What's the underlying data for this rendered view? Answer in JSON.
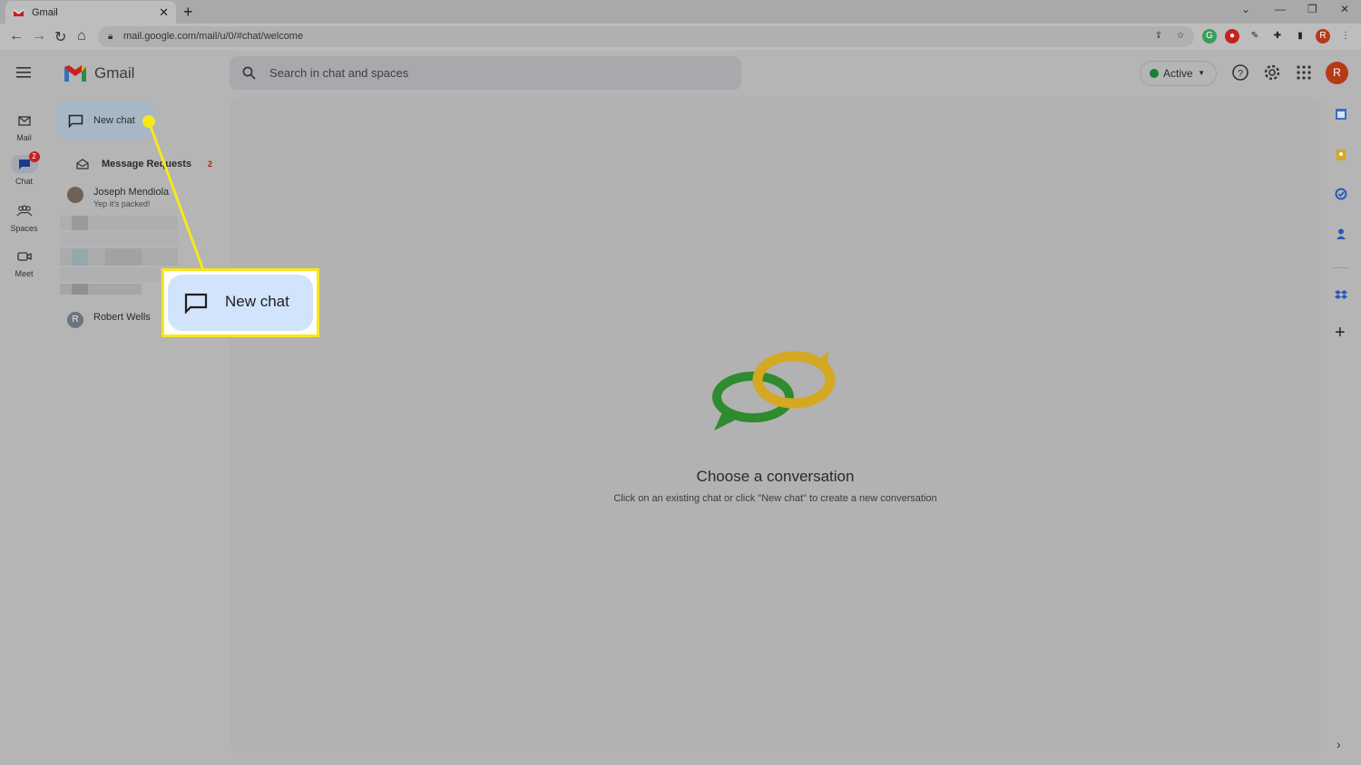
{
  "browser": {
    "tab_title": "Gmail",
    "url": "mail.google.com/mail/u/0/#chat/welcome",
    "profile_initial": "R"
  },
  "app": {
    "logo_text": "Gmail",
    "search_placeholder": "Search in chat and spaces",
    "status_label": "Active",
    "avatar_initial": "R"
  },
  "rail": {
    "items": [
      {
        "label": "Mail",
        "icon": "mail-icon"
      },
      {
        "label": "Chat",
        "icon": "chat-icon",
        "badge": "2"
      },
      {
        "label": "Spaces",
        "icon": "spaces-icon"
      },
      {
        "label": "Meet",
        "icon": "meet-icon"
      }
    ]
  },
  "sidebar": {
    "new_chat_label": "New chat",
    "message_requests_label": "Message Requests",
    "message_requests_count": "2",
    "contacts": [
      {
        "name": "Joseph Mendiola",
        "preview": "Yep it's packed!"
      },
      {
        "name": "Robert Wells",
        "initial": "R"
      }
    ]
  },
  "main": {
    "empty_title": "Choose a conversation",
    "empty_subtitle": "Click on an existing chat or click \"New chat\" to create a new conversation"
  },
  "callout": {
    "label": "New chat"
  },
  "colors": {
    "highlight": "#f8e71c",
    "active_dot": "#188038",
    "badge": "#c5221f",
    "avatar": "#b73a18"
  }
}
